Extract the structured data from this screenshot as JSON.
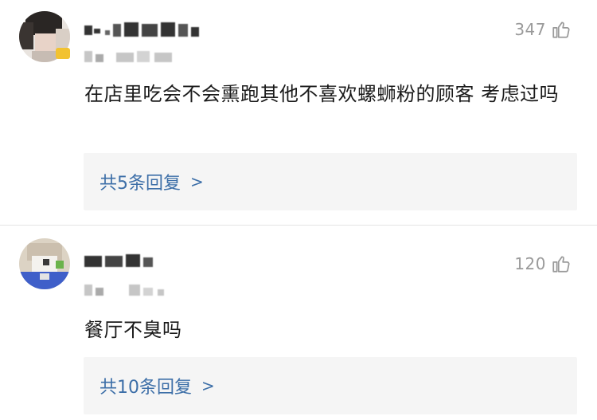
{
  "comments": [
    {
      "username": "",
      "meta": "",
      "likes": "347",
      "text": "在店里吃会不会熏跑其他不喜欢螺蛳粉的顾客 考虑过吗",
      "replies_label": "共5条回复",
      "replies_chevron": ">"
    },
    {
      "username": "",
      "meta": "",
      "likes": "120",
      "text": "餐厅不臭吗",
      "replies_label": "共10条回复",
      "replies_chevron": ">"
    }
  ],
  "icons": {
    "like": "thumb-up-icon"
  },
  "colors": {
    "reply_link": "#3d6fa8",
    "reply_bg": "#f5f5f5",
    "like_gray": "#9a9a9a"
  }
}
